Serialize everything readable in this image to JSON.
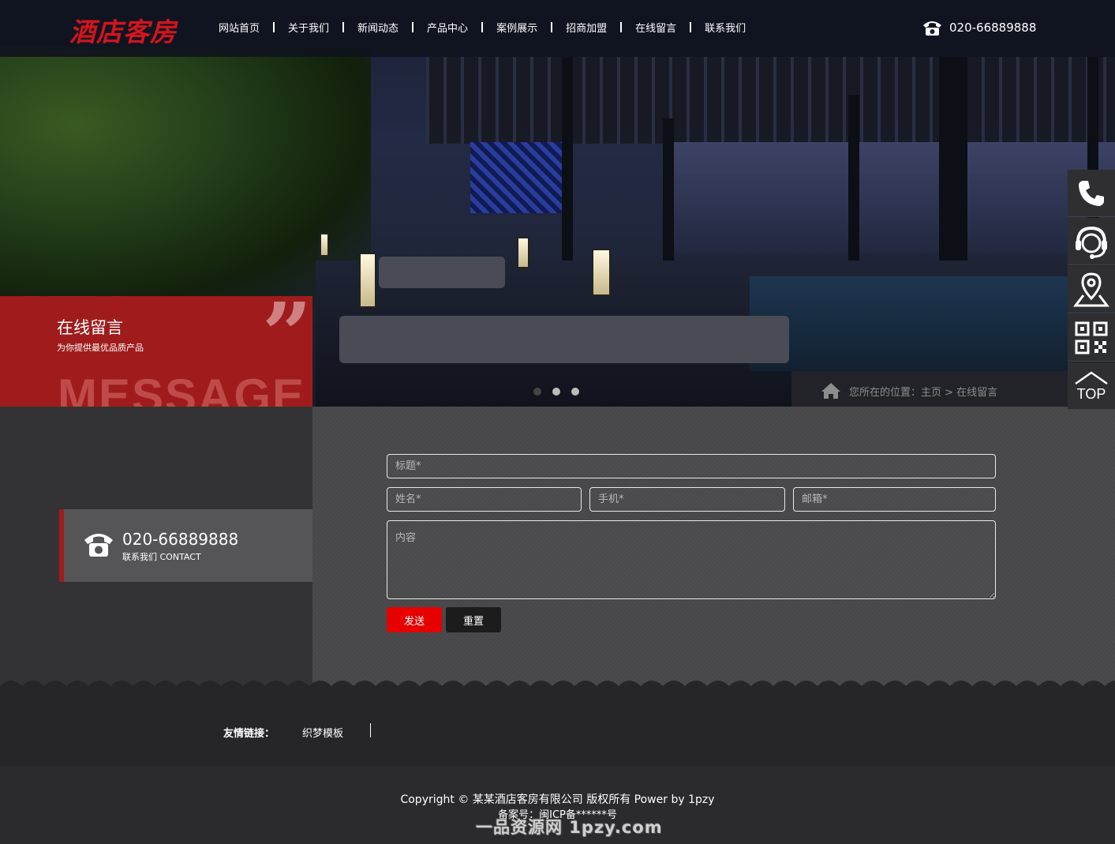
{
  "header": {
    "logo": "酒店客房",
    "nav": [
      "网站首页",
      "关于我们",
      "新闻动态",
      "产品中心",
      "案例展示",
      "招商加盟",
      "在线留言",
      "联系我们"
    ],
    "phone": "020-66889888"
  },
  "banner": {
    "breadcrumb": "您所在的位置：主页 > 在线留言",
    "slide_count": 3,
    "active_slide": 1
  },
  "message_box": {
    "title": "在线留言",
    "subtitle": "为你提供最优品质产品",
    "big_text": "MESSAGE",
    "quote": "”"
  },
  "contact": {
    "phone": "020-66889888",
    "label": "联系我们 CONTACT"
  },
  "form": {
    "title_placeholder": "标题*",
    "name_placeholder": "姓名*",
    "phone_placeholder": "手机*",
    "email_placeholder": "邮箱*",
    "content_placeholder": "内容",
    "send_label": "发送",
    "reset_label": "重置"
  },
  "float_bar": {
    "items": [
      "phone-icon",
      "headset-icon",
      "location-icon",
      "qrcode-icon",
      "top-icon"
    ],
    "top_label": "TOP"
  },
  "footer": {
    "links_label": "友情链接：",
    "links": [
      "织梦模板"
    ],
    "copyright": "Copyright © 某某酒店客房有限公司 版权所有 Power by 1pzy",
    "icp": "备案号：闽ICP备******号",
    "watermark": "一品资源网 1pzy.com"
  },
  "colors": {
    "brand_red": "#d4141c",
    "box_red": "#a01c1c",
    "send_button": "#e60000"
  }
}
